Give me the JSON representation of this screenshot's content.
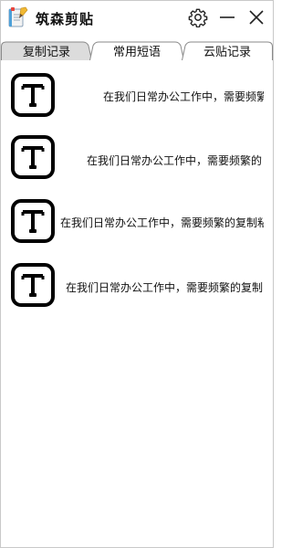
{
  "app": {
    "title": "筑森剪贴",
    "icon": "notepad-pencil-icon"
  },
  "titlebar": {
    "buttons": [
      {
        "name": "settings",
        "icon": "gear-icon"
      },
      {
        "name": "minimize",
        "icon": "minimize-icon"
      },
      {
        "name": "close",
        "icon": "close-icon"
      }
    ]
  },
  "tabs": [
    {
      "label": "复制记录",
      "active": true
    },
    {
      "label": "常用短语",
      "active": false
    },
    {
      "label": "云贴记录",
      "active": false
    }
  ],
  "clips": [
    {
      "type": "text",
      "icon": "text-t-icon",
      "preview": "在我们日常办公工作中，需要频繁"
    },
    {
      "type": "text",
      "icon": "text-t-icon",
      "preview": "在我们日常办公工作中，需要频繁的"
    },
    {
      "type": "text",
      "icon": "text-t-icon",
      "preview": "在我们日常办公工作中，需要频繁的复制粘"
    },
    {
      "type": "text",
      "icon": "text-t-icon",
      "preview": "在我们日常办公工作中，需要频繁的复制"
    }
  ],
  "colors": {
    "active_tab": "#dcdcdc",
    "inactive_tab": "#ffffff",
    "border": "#8a8a8a",
    "icon_stroke": "#000000"
  }
}
